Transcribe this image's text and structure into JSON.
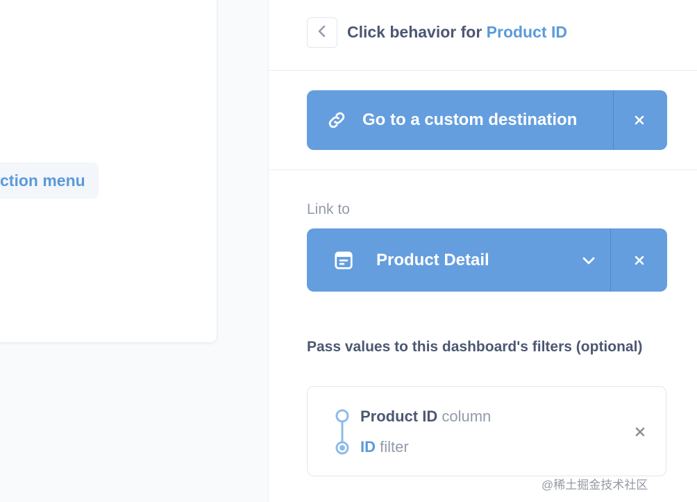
{
  "left": {
    "action_menu_label": "ction menu"
  },
  "header": {
    "title_prefix": "Click behavior for ",
    "title_accent": "Product ID"
  },
  "destination": {
    "label": "Go to a custom destination",
    "icon": "link-icon"
  },
  "link_to": {
    "label": "Link to",
    "selected": "Product Detail",
    "icon": "dashboard-icon"
  },
  "filters": {
    "heading": "Pass values to this dashboard's filters (optional)",
    "mapping": {
      "source_name": "Product ID",
      "source_suffix": " column",
      "target_name": "ID",
      "target_suffix": " filter"
    }
  },
  "watermark": "@稀土掘金技术社区",
  "colors": {
    "brand": "#509ee3",
    "bar": "#649ede",
    "text_dark": "#4c5773",
    "text_muted": "#949aab"
  }
}
